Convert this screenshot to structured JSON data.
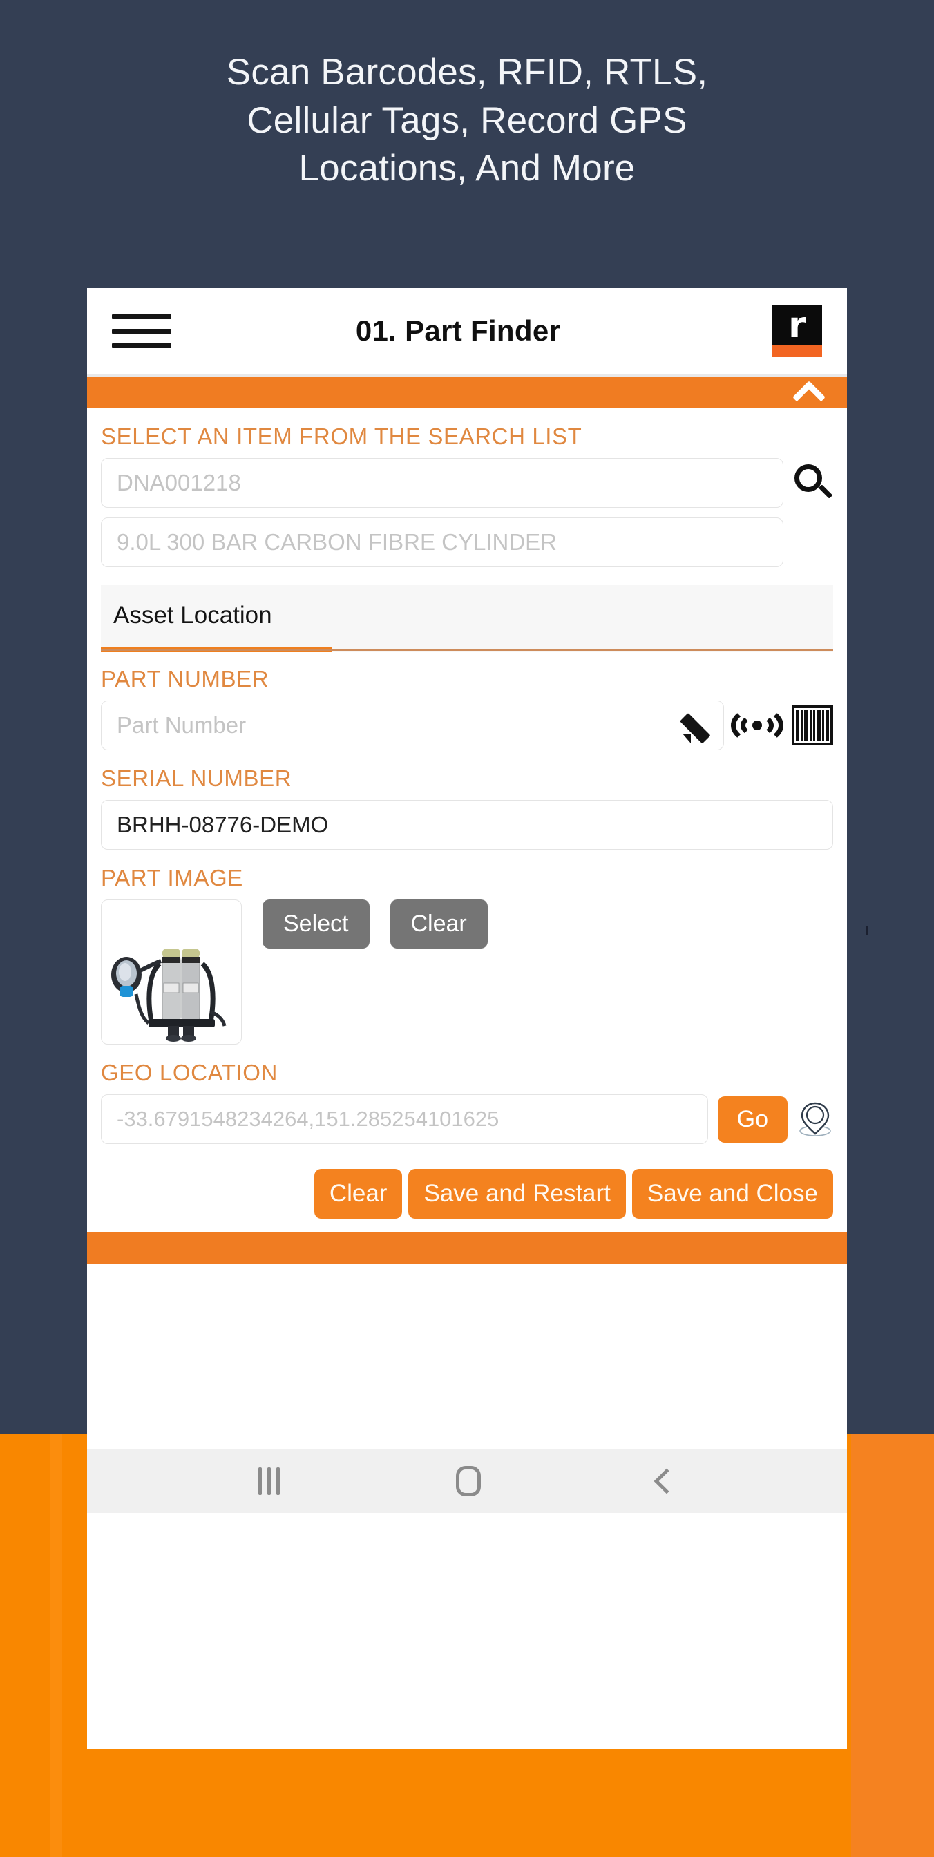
{
  "headline": {
    "line1": "Scan Barcodes, RFID, RTLS,",
    "line2": "Cellular Tags, Record GPS",
    "line3": "Locations, And More"
  },
  "colors": {
    "backdrop_dark": "#343f54",
    "backdrop_orange": "#f98700",
    "accent_orange": "#f4821f",
    "label_orange": "#e08840",
    "button_grey": "#757575"
  },
  "appbar": {
    "menu_icon": "hamburger-icon",
    "title": "01. Part Finder",
    "logo_letter": "r"
  },
  "collapse_bar": {
    "icon": "chevron-up-icon"
  },
  "search": {
    "label": "SELECT AN ITEM FROM THE SEARCH LIST",
    "item_code_placeholder": "DNA001218",
    "item_code_value": "",
    "item_desc_placeholder": "9.0L 300 BAR CARBON FIBRE CYLINDER",
    "item_desc_value": "",
    "search_icon": "search-icon"
  },
  "tabs": [
    {
      "label": "Asset Location",
      "active": true
    }
  ],
  "part_number": {
    "label": "PART NUMBER",
    "placeholder": "Part Number",
    "value": "",
    "icons": [
      "pencil-icon",
      "rfid-icon",
      "barcode-icon"
    ]
  },
  "serial_number": {
    "label": "SERIAL NUMBER",
    "value": "BRHH-08776-DEMO",
    "placeholder": "Serial Number"
  },
  "part_image": {
    "label": "PART IMAGE",
    "select_label": "Select",
    "clear_label": "Clear",
    "thumbnail_alt": "scba-breathing-apparatus-image"
  },
  "geo_location": {
    "label": "GEO LOCATION",
    "placeholder": "-33.6791548234264,151.285254101625",
    "value": "",
    "go_label": "Go",
    "pin_icon": "map-pin-icon"
  },
  "actions": {
    "clear_label": "Clear",
    "save_restart_label": "Save and Restart",
    "save_close_label": "Save and Close"
  },
  "navbar": {
    "recents_icon": "recents-icon",
    "home_icon": "home-icon",
    "back_icon": "back-icon"
  }
}
